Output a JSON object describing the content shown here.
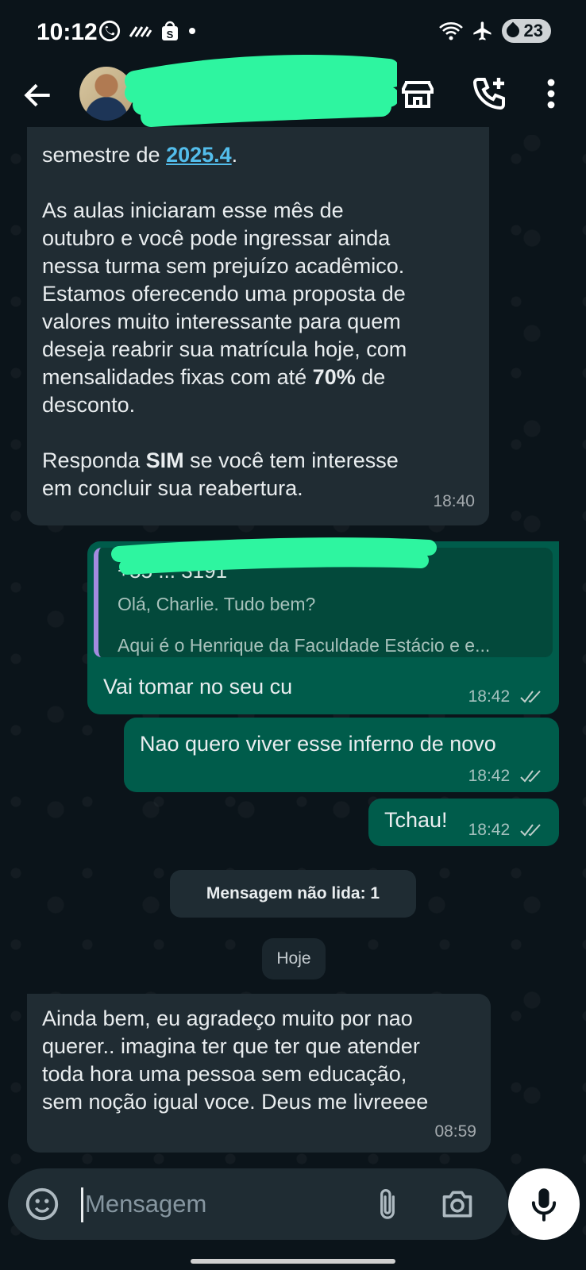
{
  "status_bar": {
    "time": "10:12",
    "battery": "23",
    "left_icons": [
      "whatsapp-icon",
      "signal-icon",
      "shopee-icon",
      "dot-icon"
    ],
    "right_icons": [
      "wifi-icon",
      "airplane-icon",
      "battery-icon"
    ]
  },
  "header": {
    "icons": [
      "back-arrow-icon",
      "avatar",
      "store-icon",
      "add-call-icon",
      "more-vert-icon"
    ]
  },
  "messages": {
    "m1": {
      "prefix": "semestre de ",
      "link": "2025.4",
      "suffix": ".",
      "p2_a": "As aulas iniciaram esse mês de",
      "p2_b": "outubro e você pode ingressar ainda",
      "p2_c": "nessa turma sem prejuízo acadêmico.",
      "p2_d": "Estamos oferecendo uma proposta de",
      "p2_e": "valores muito interessante para quem",
      "p2_f": "deseja reabrir sua matrícula hoje, com",
      "p2_g_pre": "mensalidades fixas com até ",
      "p2_g_bold": "70%",
      "p2_g_post": " de",
      "p2_h": "desconto.",
      "p3_a_pre": "Responda ",
      "p3_a_bold": "SIM",
      "p3_a_post": " se você tem interesse",
      "p3_b": "em concluir sua reabertura.",
      "time": "18:40"
    },
    "m2": {
      "quote_name": "+55 ... 3191",
      "quote_line1": "Olá, Charlie. Tudo bem?",
      "quote_line2": "Aqui é o Henrique da Faculdade Estácio  e e...",
      "text": "Vai tomar no seu cu",
      "time": "18:42"
    },
    "m3": {
      "text": "Nao quero viver esse inferno de novo",
      "time": "18:42"
    },
    "m4": {
      "text": "Tchau!",
      "time": "18:42"
    },
    "unread": "Mensagem não lida: 1",
    "date_pill": "Hoje",
    "m5": {
      "line1": "Ainda bem, eu agradeço muito por nao",
      "line2": "querer.. imagina ter que ter que atender",
      "line3": "toda hora uma pessoa sem educação,",
      "line4": "sem noção igual voce. Deus me livreeee",
      "time": "08:59"
    }
  },
  "composer": {
    "placeholder": "Mensagem",
    "icons": [
      "sticker-icon",
      "attach-icon",
      "camera-icon",
      "mic-icon"
    ]
  },
  "colors": {
    "background": "#0b141a",
    "incoming_bubble": "#202c33",
    "outgoing_bubble": "#005c4b",
    "link": "#53bdeb",
    "redaction": "#2ef5a0"
  }
}
